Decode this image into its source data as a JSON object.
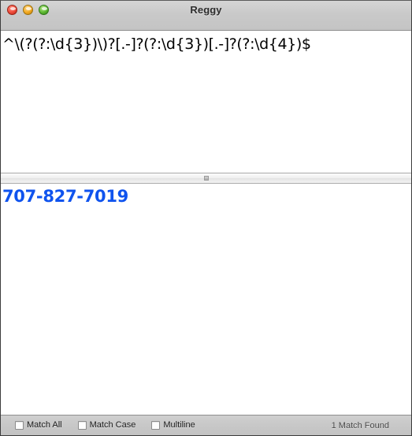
{
  "window": {
    "title": "Reggy",
    "controls": [
      {
        "name": "close",
        "color": "#ee4b3b"
      },
      {
        "name": "minimize",
        "color": "#f2a81f"
      },
      {
        "name": "zoom",
        "color": "#5db832"
      }
    ]
  },
  "pattern_pane": {
    "pattern": "^\\(?(?:\\d{3})\\)?[.-]?(?:\\d{3})[.-]?(?:\\d{4})$",
    "placeholder": ""
  },
  "splitter": {
    "grip_icon": "resize-grip-icon"
  },
  "subject_pane": {
    "text": "707-827-7019",
    "placeholder": "",
    "match_color": "#0f53ee"
  },
  "statusbar": {
    "options": [
      {
        "label": "Match All",
        "checked": false
      },
      {
        "label": "Match Case",
        "checked": false
      },
      {
        "label": "Multiline",
        "checked": false
      }
    ],
    "status": "1 Match Found"
  }
}
